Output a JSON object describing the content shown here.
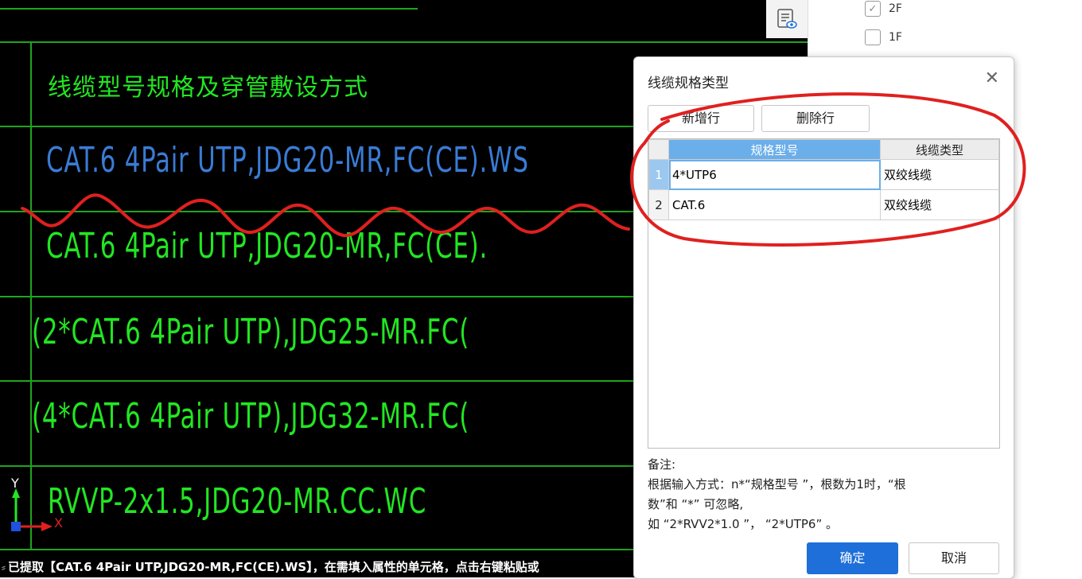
{
  "cad": {
    "heading": "线缆型号规格及穿管敷设方式",
    "rows": [
      {
        "text": "CAT.6  4Pair  UTP,JDG20-MR,FC(CE).WS",
        "color": "#3a7bd5"
      },
      {
        "text": "CAT.6  4Pair  UTP,JDG20-MR,FC(CE).",
        "color": "#22e622"
      },
      {
        "text": "(2*CAT.6  4Pair  UTP),JDG25-MR.FC(",
        "color": "#22e622"
      },
      {
        "text": "(4*CAT.6  4Pair  UTP),JDG32-MR.FC(",
        "color": "#22e622"
      },
      {
        "text": "RVVP-2x1.5,JDG20-MR.CC.WC",
        "color": "#22e622"
      }
    ],
    "axis": {
      "y": "Y",
      "x": "X"
    },
    "status_text": "已提取【CAT.6 4Pair UTP,JDG20-MR,FC(CE).WS】，在需填入属性的单元格，点击右键粘贴或"
  },
  "floors": [
    {
      "label": "2F",
      "checked": true
    },
    {
      "label": "1F",
      "checked": false
    }
  ],
  "dialog": {
    "title": "线缆规格类型",
    "add_row": "新增行",
    "delete_row": "删除行",
    "columns": [
      "规格型号",
      "线缆类型"
    ],
    "rows": [
      {
        "num": "1",
        "spec": "4*UTP6",
        "type": "双绞线缆"
      },
      {
        "num": "2",
        "spec": "CAT.6",
        "type": "双绞线缆"
      }
    ],
    "notes_title": "备注:",
    "notes_line1": "根据输入方式：n*“规格型号 ”，根数为1时，“根",
    "notes_line2": "数”和 “*” 可忽略,",
    "notes_line3": "如 “2*RVV2*1.0 ”， “2*UTP6” 。",
    "ok": "确定",
    "cancel": "取消"
  },
  "colors": {
    "accent": "#1e6fd9",
    "grid_header": "#6aaeea",
    "cad_green": "#22e622",
    "cad_blue": "#3a7bd5",
    "annotation_red": "#e0201f"
  }
}
